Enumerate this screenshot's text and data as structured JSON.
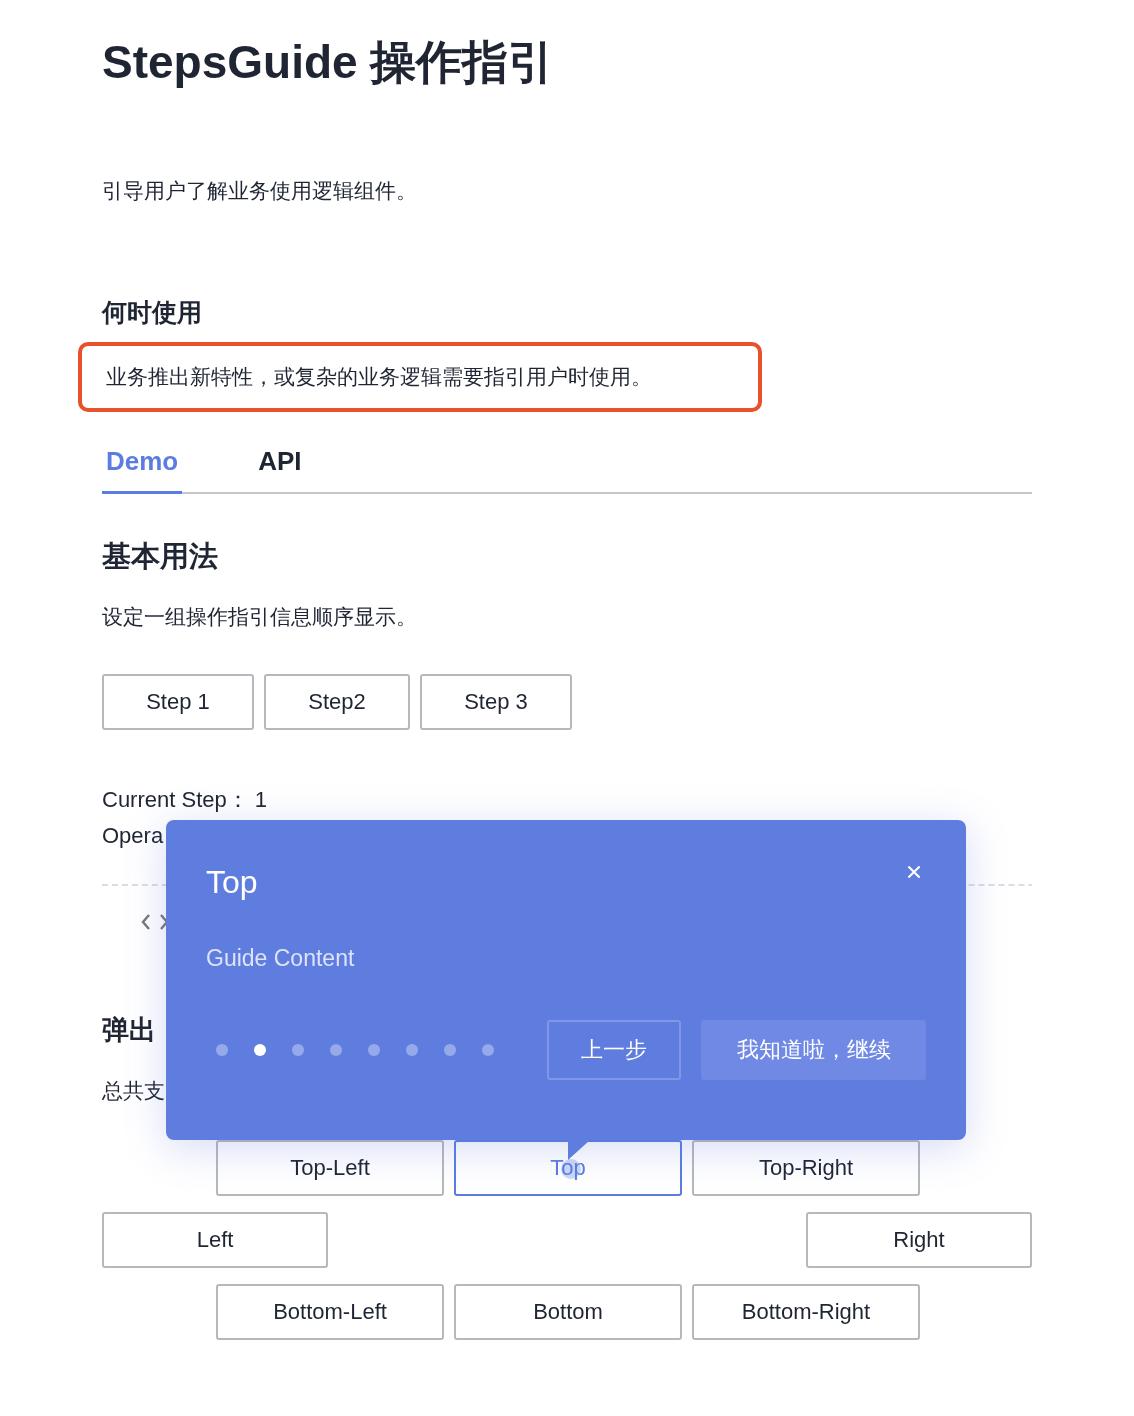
{
  "title": "StepsGuide 操作指引",
  "description": "引导用户了解业务使用逻辑组件。",
  "when_to_use": {
    "heading": "何时使用",
    "text": "业务推出新特性，或复杂的业务逻辑需要指引用户时使用。",
    "highlighted": true
  },
  "tabs": [
    {
      "label": "Demo",
      "selected": true
    },
    {
      "label": "API",
      "selected": false
    }
  ],
  "basic": {
    "heading": "基本用法",
    "text": "设定一组操作指引信息顺序显示。",
    "steps": [
      "Step 1",
      "Step2",
      "Step 3"
    ],
    "current_step": "Current Step：  1",
    "operation": "Opera"
  },
  "placement": {
    "heading": "弹出",
    "text": "总共支",
    "buttons": [
      {
        "label": "Top-Left",
        "selected": false
      },
      {
        "label": "Top",
        "selected": true
      },
      {
        "label": "Top-Right",
        "selected": false
      },
      {
        "label": "Left",
        "selected": false
      },
      {
        "label": "Right",
        "selected": false
      },
      {
        "label": "Bottom-Left",
        "selected": false
      },
      {
        "label": "Bottom",
        "selected": false
      },
      {
        "label": "Bottom-Right",
        "selected": false
      }
    ]
  },
  "guide": {
    "title": "Top",
    "content": "Guide Content",
    "dots": [
      {
        "selected": false
      },
      {
        "selected": true
      },
      {
        "selected": false
      },
      {
        "selected": false
      },
      {
        "selected": false
      },
      {
        "selected": false
      },
      {
        "selected": false
      },
      {
        "selected": false
      }
    ],
    "prev": "上一步",
    "next": "我知道啦，继续"
  }
}
